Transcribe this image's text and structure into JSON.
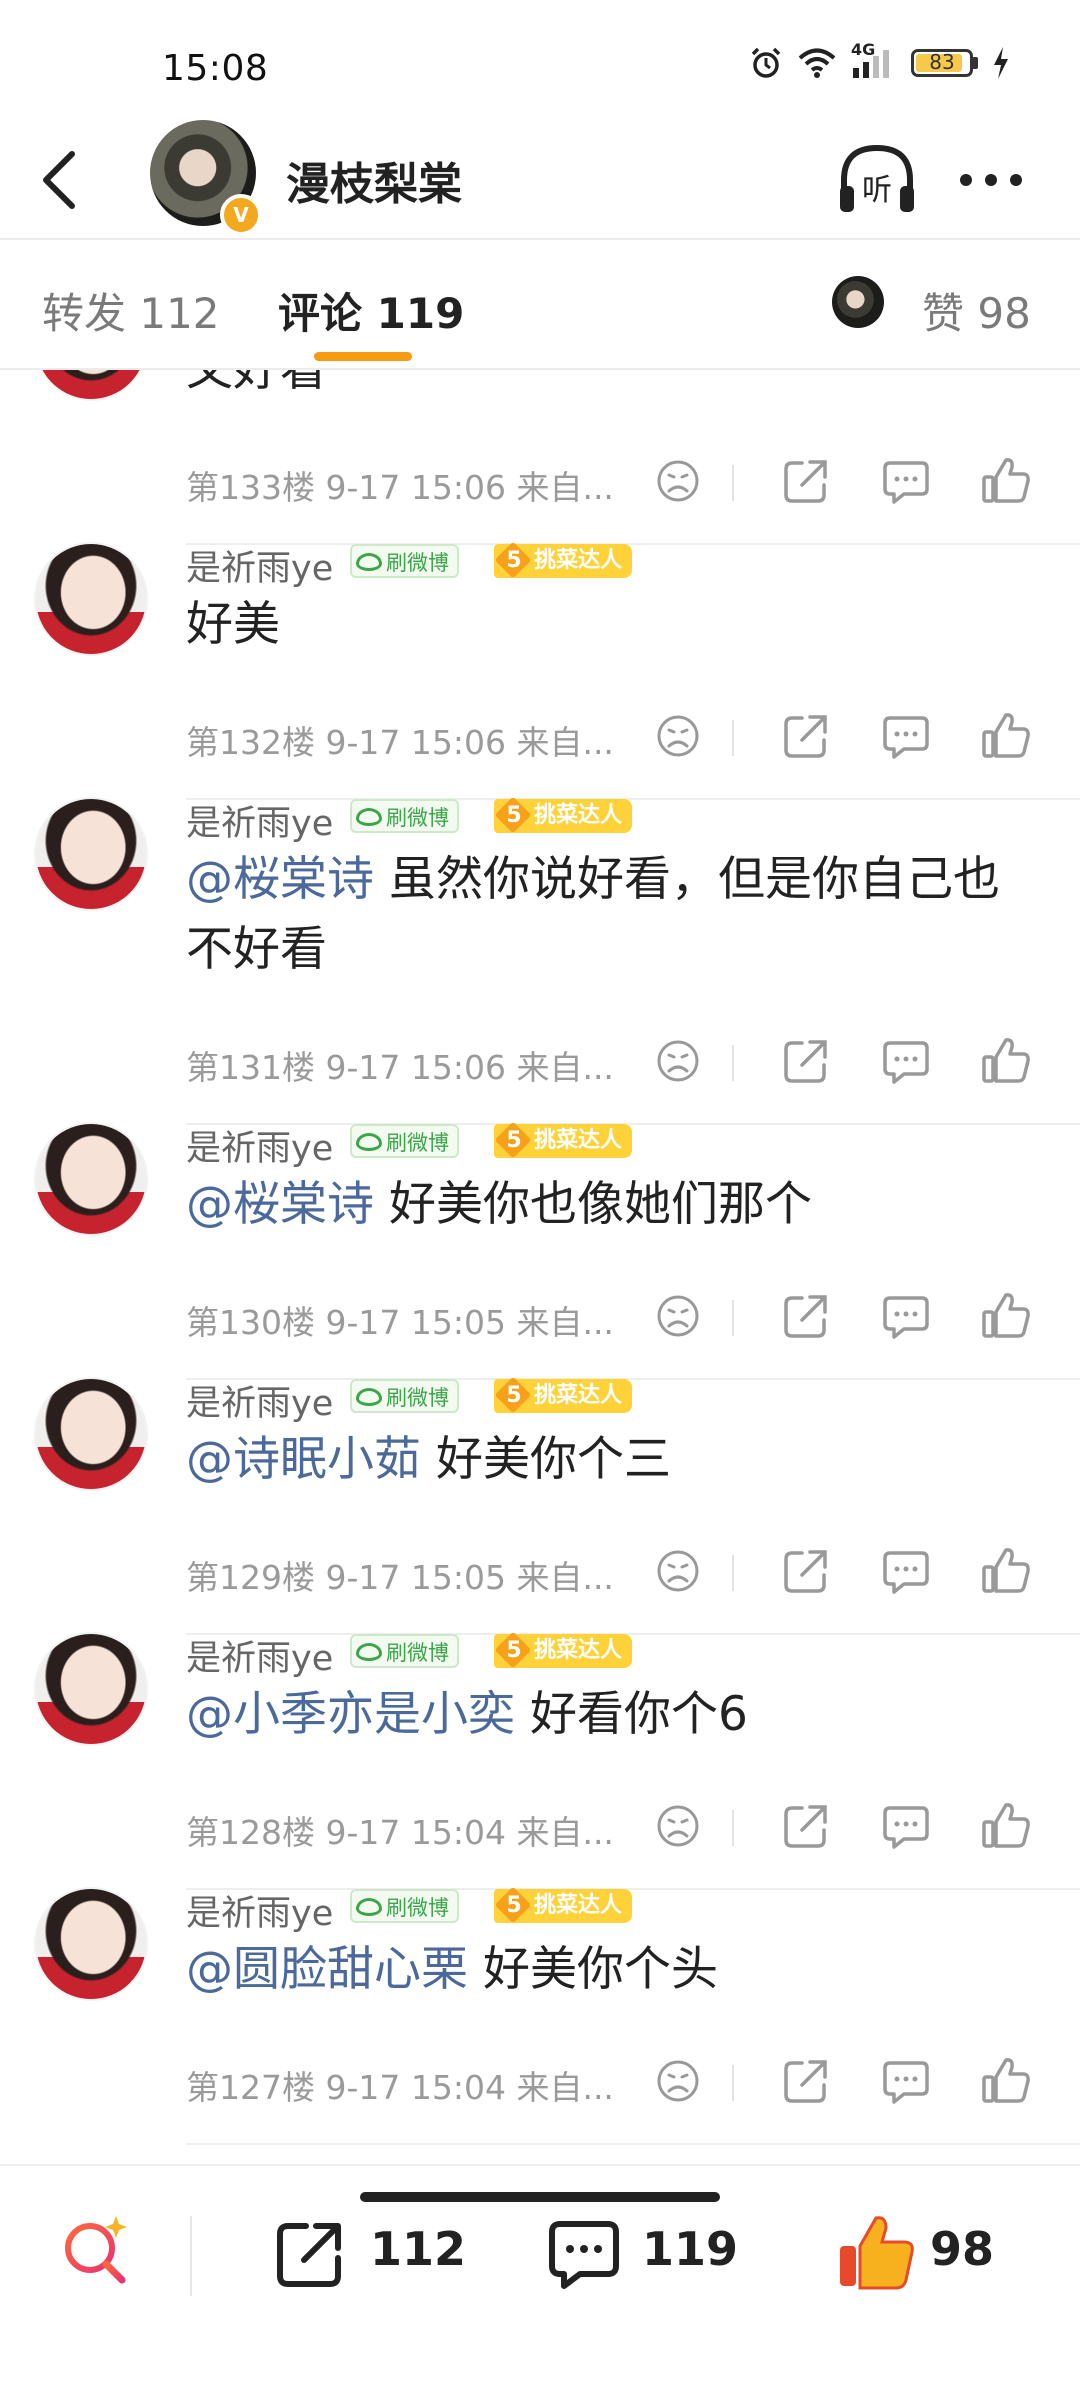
{
  "status": {
    "time": "15:08",
    "network": "4G",
    "battery": "83"
  },
  "header": {
    "profile_name": "漫枝梨棠"
  },
  "tabs": {
    "repost": "转发 112",
    "comment": "评论 119",
    "like": "赞 98"
  },
  "comments": [
    {
      "user": "是祈雨ye",
      "badge1": "刷微博",
      "badge2": "挑菜达人",
      "badge_level": "5",
      "text": "又好看",
      "mention": "",
      "meta": "第133楼  9-17 15:06  来自..."
    },
    {
      "user": "是祈雨ye",
      "badge1": "刷微博",
      "badge2": "挑菜达人",
      "badge_level": "5",
      "text": "好美",
      "mention": "",
      "meta": "第132楼  9-17 15:06  来自..."
    },
    {
      "user": "是祈雨ye",
      "badge1": "刷微博",
      "badge2": "挑菜达人",
      "badge_level": "5",
      "mention": "@桜棠诗",
      "text": " 虽然你说好看，但是你自己也不好看",
      "meta": "第131楼  9-17 15:06  来自..."
    },
    {
      "user": "是祈雨ye",
      "badge1": "刷微博",
      "badge2": "挑菜达人",
      "badge_level": "5",
      "mention": "@桜棠诗",
      "text": "  好美你也像她们那个",
      "meta": "第130楼  9-17 15:05  来自..."
    },
    {
      "user": "是祈雨ye",
      "badge1": "刷微博",
      "badge2": "挑菜达人",
      "badge_level": "5",
      "mention": "@诗眠小茹",
      "text": " 好美你个三",
      "meta": "第129楼  9-17 15:05  来自..."
    },
    {
      "user": "是祈雨ye",
      "badge1": "刷微博",
      "badge2": "挑菜达人",
      "badge_level": "5",
      "mention": "@小季亦是小奕",
      "text": " 好看你个6",
      "meta": "第128楼  9-17 15:04  来自..."
    },
    {
      "user": "是祈雨ye",
      "badge1": "刷微博",
      "badge2": "挑菜达人",
      "badge_level": "5",
      "mention": "@圆脸甜心栗",
      "text": " 好美你个头",
      "meta": "第127楼  9-17 15:04  来自..."
    }
  ],
  "bottom_bar": {
    "repost_count": "112",
    "comment_count": "119",
    "like_count": "98"
  },
  "colors": {
    "accent": "#f79c12",
    "mention": "#4b6a9b",
    "like": "#f05a24"
  }
}
